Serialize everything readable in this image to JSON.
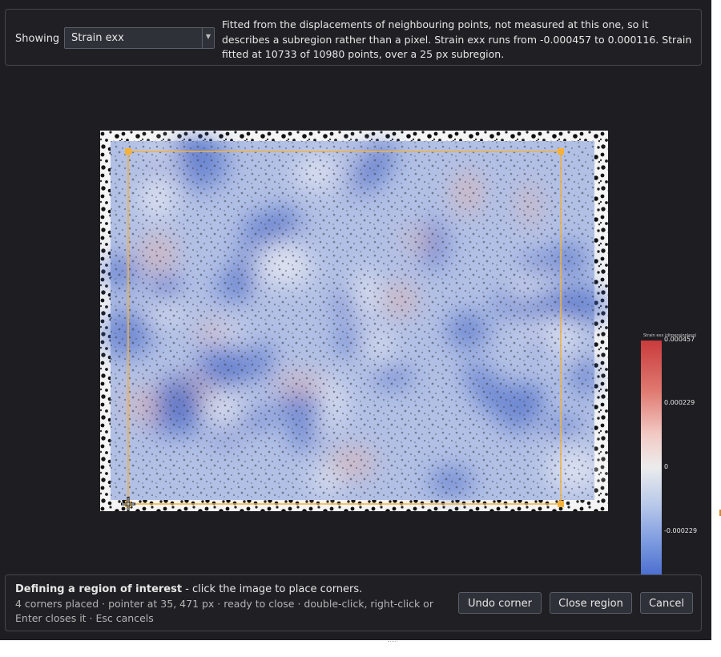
{
  "toolbar": {
    "showing_label": "Showing",
    "field_select": {
      "value": "Strain exx"
    },
    "description": "Fitted from the displacements of neighbouring points, not measured at this one, so it describes a subregion rather than a pixel. Strain exx runs from -0.000457 to 0.000116. Strain fitted at 10733 of 10980 points, over a 25 px subregion."
  },
  "colorbar": {
    "title": "Strain exx (dimensionless)",
    "labels": [
      "0.000457",
      "0.000229",
      "0",
      "-0.000229"
    ],
    "colors": [
      "#c93b3c",
      "#ececec",
      "#4d6fd0"
    ]
  },
  "region": {
    "color": "#f5b13a",
    "corners_placed": 4
  },
  "status": {
    "title_bold": "Defining a region of interest",
    "title_rest": " - click the image to place corners.",
    "detail": "4 corners placed · pointer at 35, 471 px · ready to close · double-click, right-click or Enter closes it · Esc cancels"
  },
  "buttons": {
    "undo": "Undo corner",
    "close": "Close region",
    "cancel": "Cancel"
  },
  "icons": {
    "cursor": "crosshair-icon",
    "dropdown": "chevron-down-icon"
  }
}
